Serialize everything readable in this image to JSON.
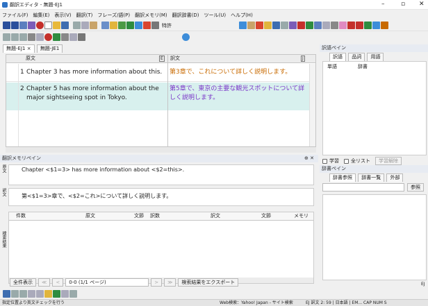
{
  "window": {
    "title": "翻訳エディタ - 無題-EJ1",
    "min_label": "–",
    "max_label": "▫",
    "close_label": "✕"
  },
  "menu": [
    "ファイル(F)",
    "編集(E)",
    "表示(V)",
    "翻訳(T)",
    "フレーズ/語(P)",
    "翻訳メモリ(M)",
    "翻訳辞書(D)",
    "ツール(U)",
    "ヘルプ(H)"
  ],
  "toolbar": {
    "field_value": "特許"
  },
  "doc_tabs": [
    {
      "label": "無題-EJ1",
      "active": true,
      "close": "×"
    },
    {
      "label": "無題-JE1",
      "active": false
    }
  ],
  "editor": {
    "source_header": "原文",
    "target_header": "訳文",
    "source_badge": "E",
    "target_badge": "J",
    "rows": [
      {
        "num": "1",
        "source": "Chapter 3 has more information about this.",
        "target": "第3章で、これについて詳しく説明します。"
      },
      {
        "num": "2",
        "source": "Chapter 5 has more information about the major sightseeing spot in Tokyo.",
        "target_black": "第5章で、東京の主要な観光スポット",
        "target_purple": "について詳しく説明します。"
      }
    ]
  },
  "memory": {
    "title": "翻訳メモリペイン",
    "close": "⊕ ✕",
    "source_label": "原文",
    "target_label": "訳文",
    "results_label": "検索結果",
    "source_text": "Chapter <$1=3> has more information about <$2=this>.",
    "target_text": "第<$1=3>章で、<$2=これ>について詳しく説明します。",
    "table_headers": [
      "件数",
      "原文",
      "文節",
      "訳数",
      "訳文",
      "文節",
      "メモリ"
    ],
    "show_all": "全件表示",
    "page_info": "0-0 (1/1 ページ)",
    "export": "検索結果をエクスポート"
  },
  "term_pane": {
    "title": "訳語ペイン",
    "tabs": [
      "訳語",
      "品詞",
      "用語"
    ],
    "col1": "単語",
    "col2": "辞書",
    "checks": [
      "学習",
      "全リスト"
    ],
    "learn_btn": "学習解除"
  },
  "dict_pane": {
    "title": "辞書ペイン",
    "tabs": [
      "辞書参照",
      "辞書一覧",
      "外部"
    ],
    "ref_btn": "参照",
    "corner": "EJ"
  },
  "statusbar": {
    "left": "指定位置より英文チェックを行う",
    "web": "Web検索：Yahoo! Japan - サイト検索",
    "right": "EJ 訳文  2: 59 | 日本語 | EM... CAP NUM S"
  },
  "colors": {
    "purple": "#7a34c8",
    "orange": "#c86a00",
    "blue": "#1a4fb0",
    "selection": "#d8f0ee"
  }
}
